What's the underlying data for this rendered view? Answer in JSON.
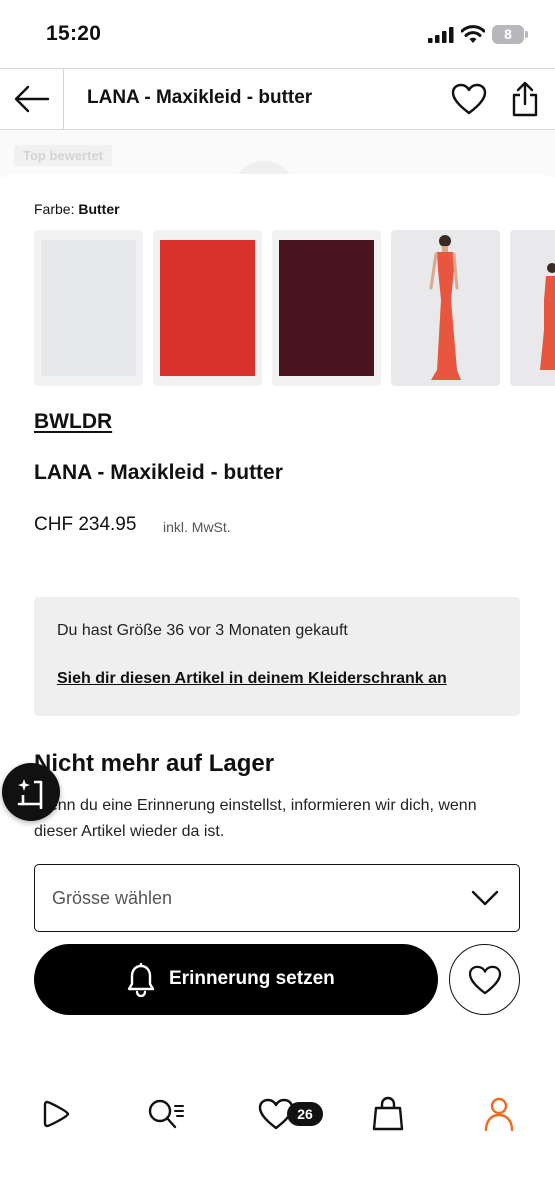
{
  "status": {
    "time": "15:20",
    "battery": "8"
  },
  "header": {
    "title": "LANA - Maxikleid - butter"
  },
  "faded": {
    "badge": "Top bewertet"
  },
  "product": {
    "color_label": "Farbe:",
    "color_value": "Butter",
    "swatches": [
      {
        "name": "butter",
        "color": "#e6e8ec"
      },
      {
        "name": "red",
        "color": "#d8322b"
      },
      {
        "name": "burgundy",
        "color": "#4a1320"
      },
      {
        "name": "coral-model",
        "color": "#e8563f"
      },
      {
        "name": "coral-model-partial",
        "color": "#e8563f"
      }
    ],
    "brand": "BWLDR",
    "name": "LANA - Maxikleid - butter",
    "price": "CHF 234.95",
    "vat": "inkl. MwSt."
  },
  "purchase_note": {
    "text": "Du hast Größe 36 vor 3 Monaten gekauft",
    "link": "Sieh dir diesen Artikel in deinem Kleiderschrank an"
  },
  "stock": {
    "title": "Nicht mehr auf Lager",
    "description": "Wenn du eine Erinnerung einstellst, informieren wir dich, wenn dieser Artikel wieder da ist."
  },
  "size_select": {
    "placeholder": "Grösse wählen"
  },
  "reminder": {
    "label": "Erinnerung setzen"
  },
  "nav": {
    "items": [
      "home-icon",
      "search-icon",
      "wishlist-icon",
      "bag-icon",
      "profile-icon"
    ],
    "wishlist_count": "26"
  },
  "colors": {
    "accent": "#f26a1b",
    "button": "#000000",
    "note_bg": "#efeff0"
  }
}
